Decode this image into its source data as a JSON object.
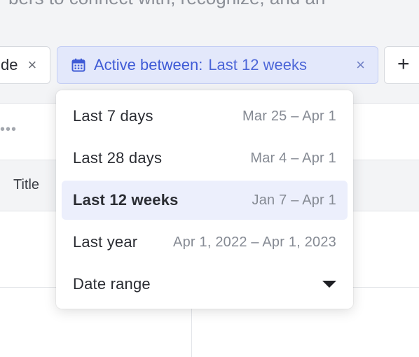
{
  "banner": {
    "text": "bers to connect with, recognize, and an"
  },
  "filters": {
    "previous_chip_label": "de",
    "active_chip": {
      "icon": "calendar-icon",
      "key": "Active between:",
      "value": "Last 12 weeks",
      "color": "#3f5bd6"
    },
    "close_glyph": "×",
    "add_glyph": "+"
  },
  "table": {
    "more_glyph": "•••",
    "columns": [
      "Title"
    ]
  },
  "dropdown": {
    "selected_index": 2,
    "options": [
      {
        "label": "Last 7 days",
        "range": "Mar 25 – Apr 1"
      },
      {
        "label": "Last 28 days",
        "range": "Mar 4 – Apr 1"
      },
      {
        "label": "Last 12 weeks",
        "range": "Jan 7 – Apr 1"
      },
      {
        "label": "Last year",
        "range": "Apr 1, 2022 – Apr 1, 2023"
      },
      {
        "label": "Date range",
        "range": ""
      }
    ],
    "date_range_icon": "caret-down-icon"
  }
}
